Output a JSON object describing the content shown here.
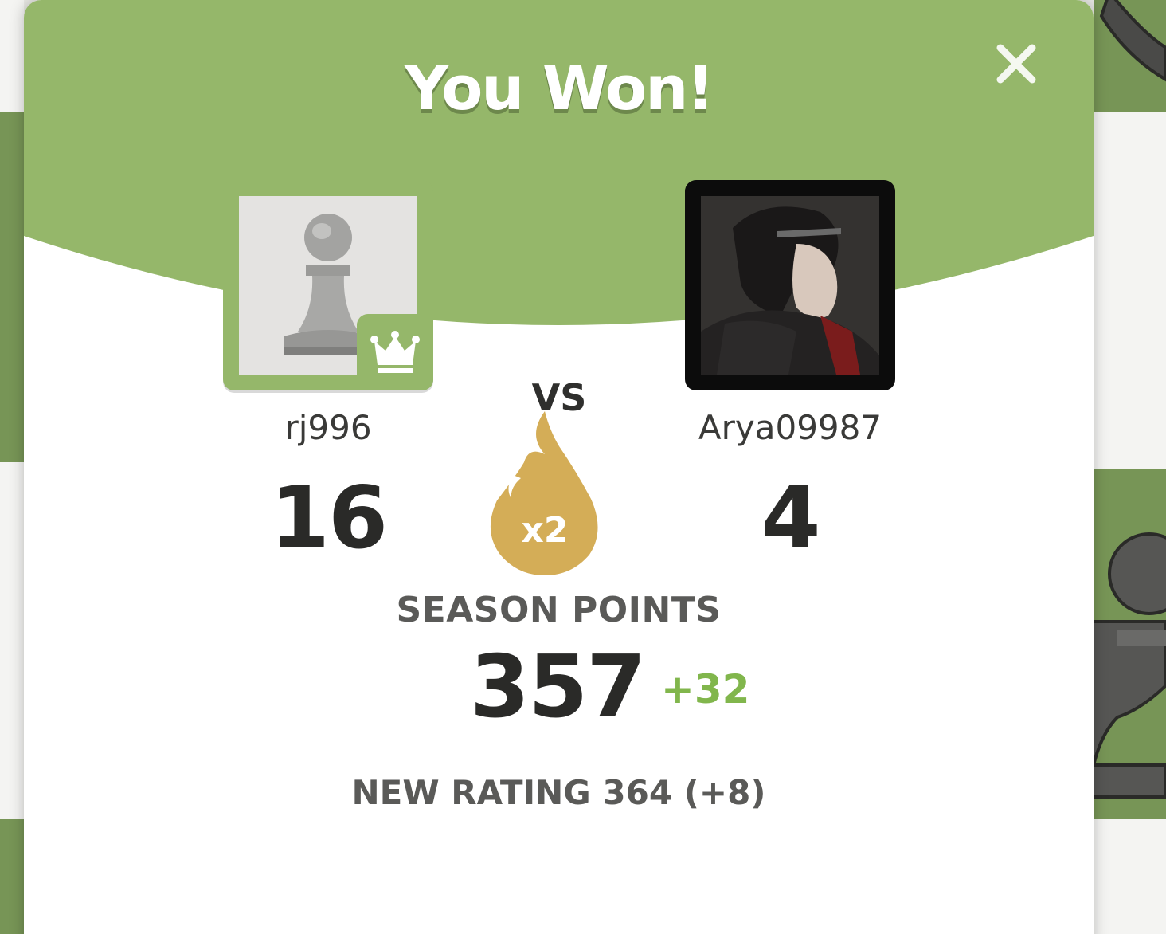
{
  "modal": {
    "title": "You Won!",
    "close_icon": "close-icon"
  },
  "players": {
    "left": {
      "username": "rj996",
      "score": "16",
      "avatar_icon": "pawn-icon",
      "badge_icon": "crown-icon"
    },
    "vs_label": "VS",
    "right": {
      "username": "Arya09987",
      "score": "4",
      "avatar_icon": "user-avatar-image"
    }
  },
  "multiplier": {
    "label": "x2",
    "icon": "flame-icon"
  },
  "season": {
    "label": "SEASON POINTS",
    "value": "357",
    "delta": "+32"
  },
  "rating": {
    "text": "NEW RATING 364 (+8)"
  },
  "colors": {
    "header_green": "#95b76a",
    "delta_green": "#81b64c",
    "flame_gold": "#d4ad57",
    "board_dark": "#779556"
  }
}
